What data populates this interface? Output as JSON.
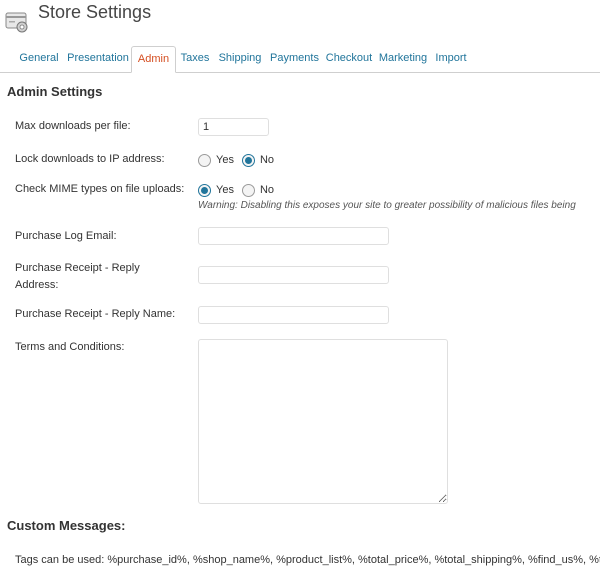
{
  "header": {
    "title": "Store Settings",
    "icon": "store-settings-icon"
  },
  "tabs": [
    {
      "label": "General"
    },
    {
      "label": "Presentation"
    },
    {
      "label": "Admin",
      "active": true
    },
    {
      "label": "Taxes"
    },
    {
      "label": "Shipping"
    },
    {
      "label": "Payments"
    },
    {
      "label": "Checkout"
    },
    {
      "label": "Marketing"
    },
    {
      "label": "Import"
    }
  ],
  "admin": {
    "title": "Admin Settings",
    "max_downloads": {
      "label": "Max downloads per file:",
      "value": "1"
    },
    "lock_ip": {
      "label": "Lock downloads to IP address:",
      "yes": "Yes",
      "no": "No",
      "selected": "No"
    },
    "mime": {
      "label": "Check MIME types on file uploads:",
      "yes": "Yes",
      "no": "No",
      "selected": "Yes",
      "warning": "Warning: Disabling this exposes your site to greater possibility of malicious files being"
    },
    "log_email": {
      "label": "Purchase Log Email:",
      "value": ""
    },
    "reply_address": {
      "label_line1": "Purchase Receipt - Reply",
      "label_line2": "Address:",
      "value": ""
    },
    "reply_name": {
      "label": "Purchase Receipt - Reply Name:",
      "value": ""
    },
    "terms": {
      "label": "Terms and Conditions:",
      "value": ""
    }
  },
  "custom_messages": {
    "title": "Custom Messages:",
    "tags": "Tags can be used: %purchase_id%, %shop_name%, %product_list%, %total_price%, %total_shipping%, %find_us%, %t"
  },
  "colors": {
    "link": "#21759b",
    "active_tab": "#d54e21",
    "border": "#cfcfcf"
  }
}
